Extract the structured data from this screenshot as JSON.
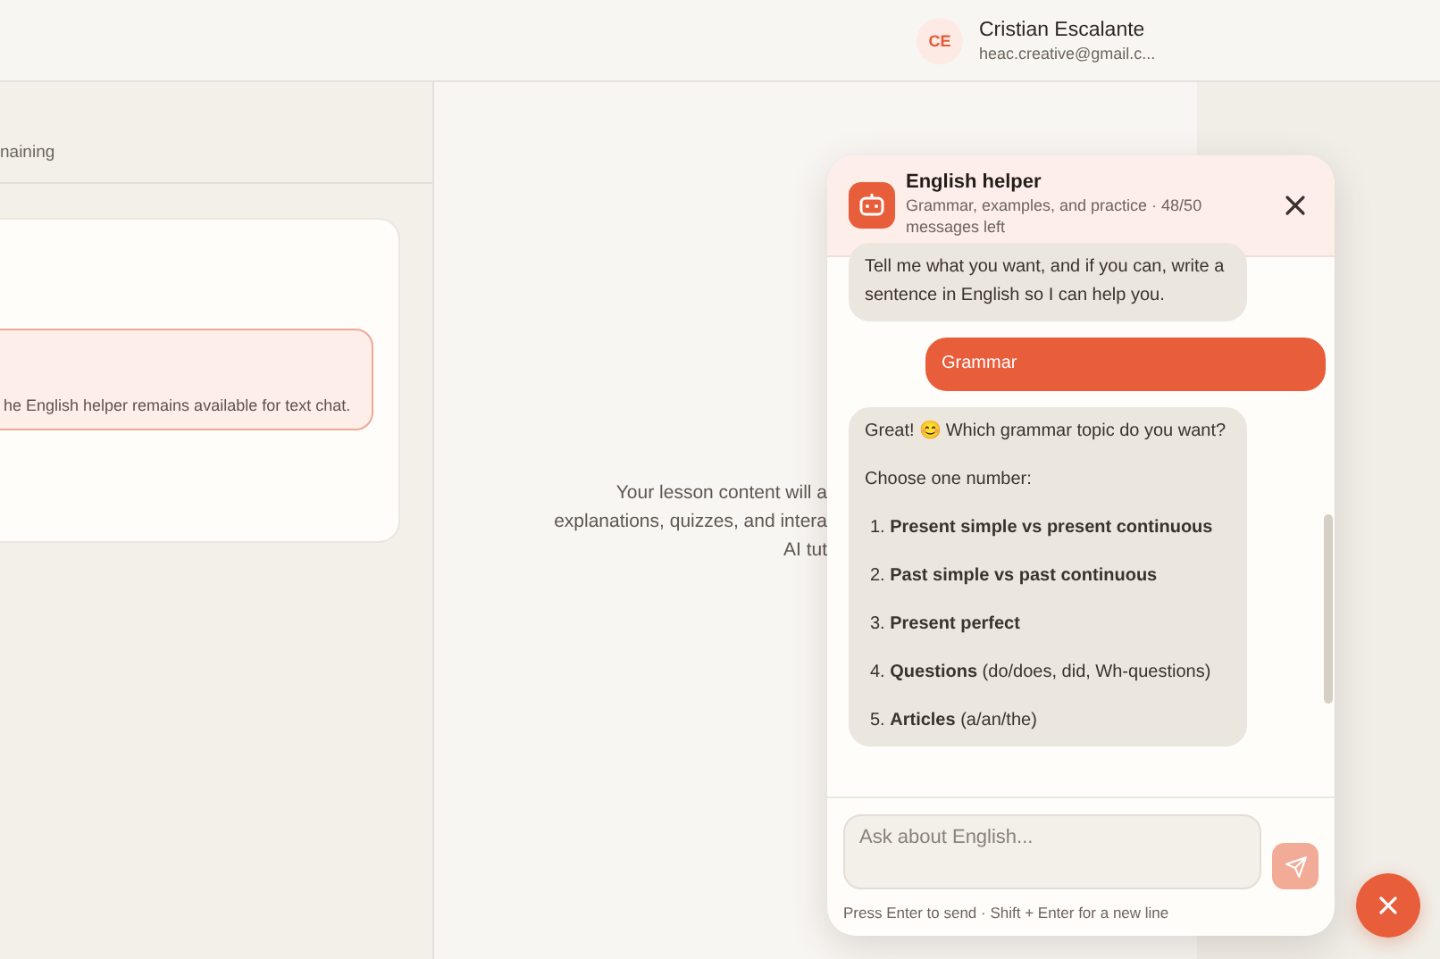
{
  "header": {
    "user": {
      "initials": "CE",
      "name": "Cristian Escalante",
      "email": "heac.creative@gmail.c..."
    }
  },
  "left_panel": {
    "status_text": "naining",
    "alert": {
      "text": "he English helper remains available for text chat."
    }
  },
  "lesson": {
    "placeholder_lines": [
      "Your lesson content will a",
      "explanations, quizzes, and intera",
      "AI tut"
    ]
  },
  "chat": {
    "title": "English helper",
    "subtitle": "Grammar, examples, and practice · 48/50 messages left",
    "messages": [
      {
        "kind": "assistant",
        "paragraphs": [
          "Tell me what you want, and if you can, write a sentence in English so I can help you."
        ]
      },
      {
        "kind": "user",
        "paragraphs": [
          "Grammar"
        ]
      },
      {
        "kind": "assistant",
        "paragraphs": [
          "Great! 😊 Which grammar topic do you want?",
          "Choose one number:"
        ],
        "list": [
          "1. **Present simple vs present continuous**",
          "2. **Past simple vs past continuous**",
          "3. **Present perfect**",
          "4. **Questions** (do/does, did, Wh-questions)",
          "5. **Articles** (a/an/the)"
        ]
      }
    ],
    "input": {
      "placeholder": "Ask about English..."
    },
    "hint": "Press Enter to send · Shift + Enter for a new line"
  }
}
